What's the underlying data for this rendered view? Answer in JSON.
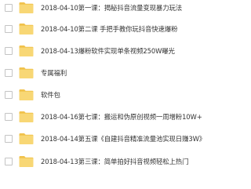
{
  "file_list": {
    "items": [
      {
        "name": "2018-04-10第一课：揭秘抖音流量变现暴力玩法",
        "icon": "folder-icon"
      },
      {
        "name": "2018-04-10第二课 手把手教你玩抖音快速爆粉",
        "icon": "folder-icon"
      },
      {
        "name": "2018-04-13爆粉软件实现单条视频250W曝光",
        "icon": "folder-icon"
      },
      {
        "name": "专属福利",
        "icon": "folder-icon"
      },
      {
        "name": "软件包",
        "icon": "folder-icon"
      },
      {
        "name": "2018-04-16第七课：搬运和伪原创视频一周增粉10W+",
        "icon": "folder-icon"
      },
      {
        "name": "2018-04-14第五课《自建抖音精准流量池实现日赚3W》",
        "icon": "folder-icon"
      },
      {
        "name": "2018-04-13第三课：简单拍好抖音视频轻松上热门",
        "icon": "folder-icon"
      }
    ]
  },
  "colors": {
    "folder_body": "#f8d775",
    "folder_tab": "#f1c24c",
    "text": "#333333",
    "checkbox_border": "#c4c4c4"
  }
}
